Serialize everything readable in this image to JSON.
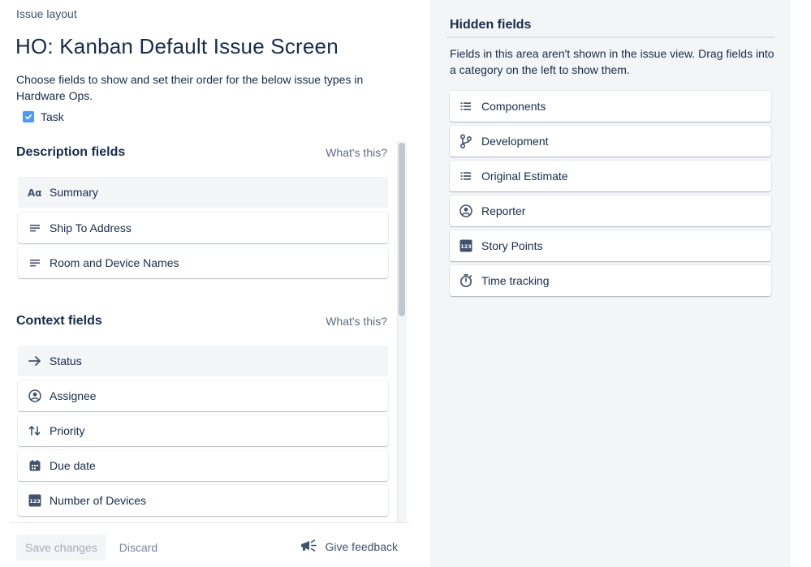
{
  "breadcrumb": "Issue layout",
  "page_title": "HO: Kanban Default Issue Screen",
  "description": "Choose fields to show and set their order for the below issue types in Hardware Ops.",
  "issue_types": [
    {
      "label": "Task",
      "checked": true
    }
  ],
  "description_section": {
    "heading": "Description fields",
    "help_link": "What's this?",
    "fields": [
      {
        "label": "Summary",
        "icon": "text-format-icon",
        "locked": true
      },
      {
        "label": "Ship To Address",
        "icon": "paragraph-icon",
        "locked": false
      },
      {
        "label": "Room and Device Names",
        "icon": "paragraph-icon",
        "locked": false
      }
    ]
  },
  "context_section": {
    "heading": "Context fields",
    "help_link": "What's this?",
    "fields": [
      {
        "label": "Status",
        "icon": "arrow-right-icon",
        "locked": true
      },
      {
        "label": "Assignee",
        "icon": "person-circle-icon",
        "locked": false
      },
      {
        "label": "Priority",
        "icon": "priority-arrows-icon",
        "locked": false
      },
      {
        "label": "Due date",
        "icon": "calendar-icon",
        "locked": false
      },
      {
        "label": "Number of Devices",
        "icon": "number-icon",
        "locked": false
      }
    ]
  },
  "footer": {
    "save_label": "Save changes",
    "discard_label": "Discard",
    "feedback_label": "Give feedback"
  },
  "hidden_fields": {
    "heading": "Hidden fields",
    "description": "Fields in this area aren't shown in the issue view. Drag fields into a category on the left to show them.",
    "fields": [
      {
        "label": "Components",
        "icon": "list-icon"
      },
      {
        "label": "Development",
        "icon": "branch-icon"
      },
      {
        "label": "Original Estimate",
        "icon": "list-icon"
      },
      {
        "label": "Reporter",
        "icon": "person-circle-icon"
      },
      {
        "label": "Story Points",
        "icon": "number-icon"
      },
      {
        "label": "Time tracking",
        "icon": "stopwatch-icon"
      }
    ]
  },
  "colors": {
    "accent": "#4c9aff",
    "text": "#172b4d",
    "subtle": "#5e6c84",
    "panel_bg": "#f4f5f7"
  }
}
